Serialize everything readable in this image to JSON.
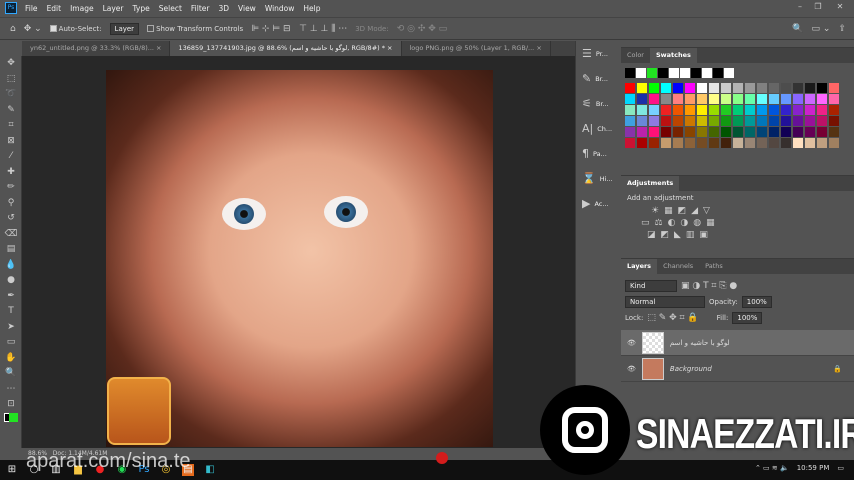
{
  "menu": {
    "items": [
      "File",
      "Edit",
      "Image",
      "Layer",
      "Type",
      "Select",
      "Filter",
      "3D",
      "View",
      "Window",
      "Help"
    ]
  },
  "options": {
    "auto_select": "Auto-Select:",
    "auto_select_target": "Layer",
    "show_transform": "Show Transform Controls",
    "mode_3d": "3D Mode:"
  },
  "tabs": [
    {
      "label": "yn62_untitled.png @ 33.3% (RGB/8)... ×",
      "active": false
    },
    {
      "label": "136859_137741903.jpg @ 88.6% (لوگو با حاشیه و اسم, RGB/8#) * ×",
      "active": true
    },
    {
      "label": "logo PNG.png @ 50% (Layer 1, RGB/... ×",
      "active": false
    }
  ],
  "status": {
    "zoom": "88.6%",
    "doc": "Doc: 1.14M/4.61M"
  },
  "dock": [
    {
      "icon": "properties-icon",
      "label": "Pr..."
    },
    {
      "icon": "brush-icon",
      "label": "Br..."
    },
    {
      "icon": "brush-settings-icon",
      "label": "Br..."
    },
    {
      "icon": "character-icon",
      "label": "Ch..."
    },
    {
      "icon": "paragraph-icon",
      "label": "Pa..."
    },
    {
      "icon": "history-icon",
      "label": "Hi..."
    },
    {
      "icon": "actions-icon",
      "label": "Ac..."
    }
  ],
  "color_panel": {
    "tabs": [
      "Color",
      "Swatches"
    ],
    "active": "Swatches",
    "recent": [
      "#000000",
      "#ffffff",
      "#22e322",
      "#000000",
      "#ffffff",
      "#ffffff",
      "#000000",
      "#ffffff",
      "#000000",
      "#ffffff"
    ],
    "swatches": [
      "#ff0000",
      "#ffff00",
      "#00ff00",
      "#00ffff",
      "#0000ff",
      "#ff00ff",
      "#ffffff",
      "#e6e6e6",
      "#cccccc",
      "#b3b3b3",
      "#999999",
      "#808080",
      "#666666",
      "#4d4d4d",
      "#333333",
      "#1a1a1a",
      "#000000",
      "#ff6666",
      "#00d7ff",
      "#1c2fa8",
      "#ff1188",
      "#888888",
      "#ff7f7f",
      "#ff9a66",
      "#ffc966",
      "#ffff88",
      "#ccff88",
      "#88ff88",
      "#66ffaa",
      "#66ffff",
      "#66ccff",
      "#6699ff",
      "#8866ff",
      "#cc66ff",
      "#ff66ff",
      "#ff66aa",
      "#88e8c0",
      "#7fe8e0",
      "#77d0ff",
      "#ee2222",
      "#ee5500",
      "#ff9900",
      "#ffee00",
      "#99dd00",
      "#22cc22",
      "#00cc77",
      "#00cccc",
      "#0099ee",
      "#0055dd",
      "#3322cc",
      "#8822cc",
      "#cc22cc",
      "#ee2288",
      "#aa2200",
      "#3fa0e0",
      "#6a88d8",
      "#8e7ae0",
      "#bb1111",
      "#bb4400",
      "#cc7700",
      "#ccbb00",
      "#77aa00",
      "#119911",
      "#009955",
      "#009999",
      "#0077bb",
      "#0044aa",
      "#221199",
      "#661199",
      "#991199",
      "#bb1166",
      "#771100",
      "#8833aa",
      "#bb22aa",
      "#ff1177",
      "#770000",
      "#772200",
      "#884400",
      "#887700",
      "#446600",
      "#005500",
      "#005533",
      "#006666",
      "#004477",
      "#002266",
      "#110055",
      "#440055",
      "#660055",
      "#770033",
      "#553311",
      "#cc1133",
      "#aa0000",
      "#992200",
      "#c69c6d",
      "#a67c52",
      "#8c6239",
      "#754c24",
      "#603913",
      "#42210b",
      "#c7b299",
      "#998675",
      "#736357",
      "#534741",
      "#362f2d",
      "#ffe0c0",
      "#e0c0a0",
      "#c0a080",
      "#a08060"
    ]
  },
  "adjustments": {
    "title": "Adjustments",
    "subtitle": "Add an adjustment"
  },
  "layers_panel": {
    "tabs": [
      "Layers",
      "Channels",
      "Paths"
    ],
    "kind": "Kind",
    "blend": "Normal",
    "opacity_label": "Opacity:",
    "opacity": "100%",
    "lock_label": "Lock:",
    "fill_label": "Fill:",
    "fill": "100%",
    "layers": [
      {
        "name": "لوگو با حاشیه و اسم",
        "active": true
      },
      {
        "name": "Background",
        "active": false,
        "locked": true
      }
    ]
  },
  "taskbar": {
    "time": "10:59 PM"
  },
  "watermark": {
    "site": "SINAEZZATI.IR",
    "aparat": "aparat.com/sina.te",
    "badge": "SINA EZZATI"
  }
}
